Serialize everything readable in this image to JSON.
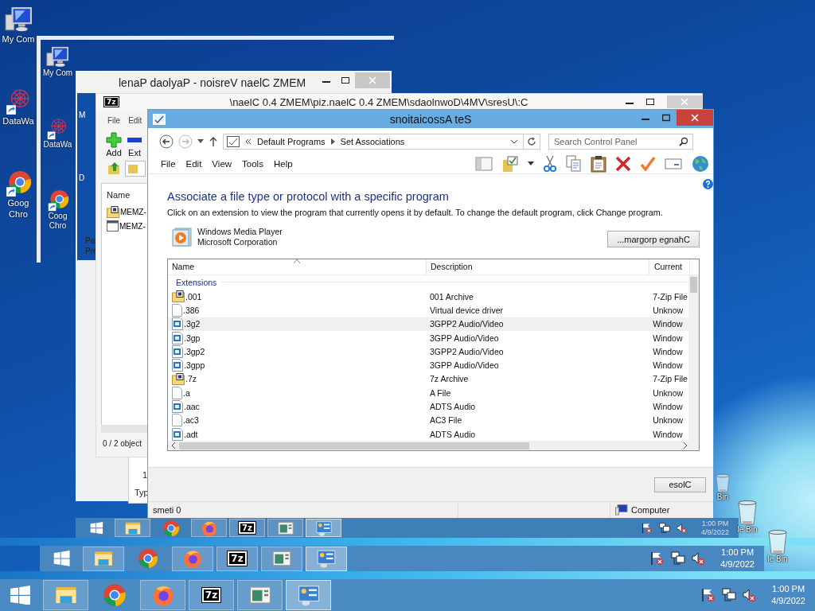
{
  "desktop": {
    "icon_columns": [
      [
        {
          "kind": "computer",
          "lines": [
            "My Com"
          ]
        },
        {
          "kind": "mesh",
          "lines": [
            "DataWa"
          ]
        },
        {
          "kind": "chrome",
          "lines": [
            "Goog",
            "Chro"
          ]
        }
      ],
      [
        {
          "kind": "computer",
          "lines": [
            "My Com"
          ]
        },
        {
          "kind": "mesh",
          "lines": [
            "DataWa"
          ]
        },
        {
          "kind": "chrome",
          "lines": [
            "Coog",
            "Chro"
          ]
        }
      ]
    ],
    "inner_labels": [
      "M",
      "D"
    ],
    "recycle_bins": [
      "Bin",
      "le Bin",
      "le Bin"
    ]
  },
  "taskbars": [
    {
      "items": [
        {
          "kind": "start"
        },
        {
          "kind": "explorer",
          "running": true,
          "selected": false
        },
        {
          "kind": "chrome",
          "running": false,
          "selected": false
        },
        {
          "kind": "firefox",
          "running": true,
          "selected": false
        },
        {
          "kind": "archiver",
          "label": "7z",
          "running": true,
          "selected": false
        },
        {
          "kind": "app",
          "running": true,
          "selected": false
        },
        {
          "kind": "control-panel",
          "running": true,
          "selected": true
        }
      ],
      "time": "1:00 PM",
      "date": "4/9/2022"
    },
    {
      "items": [
        {
          "kind": "start"
        },
        {
          "kind": "explorer",
          "running": true,
          "selected": false
        },
        {
          "kind": "chrome",
          "running": false,
          "selected": false
        },
        {
          "kind": "firefox",
          "running": true,
          "selected": false
        },
        {
          "kind": "archiver",
          "label": "7z",
          "running": true,
          "selected": false
        },
        {
          "kind": "app",
          "running": true,
          "selected": false
        },
        {
          "kind": "control-panel",
          "running": true,
          "selected": true
        }
      ],
      "time": "1:00 PM",
      "date": "4/9/2022"
    },
    {
      "items": [
        {
          "kind": "start"
        },
        {
          "kind": "explorer",
          "running": true,
          "selected": false
        },
        {
          "kind": "chrome",
          "running": false,
          "selected": false
        },
        {
          "kind": "firefox",
          "running": true,
          "selected": false
        },
        {
          "kind": "archiver",
          "label": "7z",
          "running": true,
          "selected": false
        },
        {
          "kind": "app",
          "running": true,
          "selected": false
        },
        {
          "kind": "control-panel",
          "running": true,
          "selected": true
        }
      ],
      "time": "1:00 PM",
      "date": "4/9/2022"
    }
  ],
  "payload_window": {
    "title": "lenaP daolyaP - noisreV naelC ZMEM",
    "labels": [
      "Pa",
      "Pre"
    ],
    "fragments": [
      "1",
      "Typ"
    ]
  },
  "archive_window": {
    "logo": "7z",
    "title": "\\naelC 0.4 ZMEM\\piz.naelC 0.4 ZMEM\\sdaolnwoD\\4MV\\sresU\\:C",
    "menu": [
      "File",
      "Edit"
    ],
    "tools": [
      {
        "kind": "add",
        "label": "Add"
      },
      {
        "kind": "extract",
        "label": "Ext"
      }
    ],
    "column": "Name",
    "files": [
      {
        "kind": "archive",
        "name": "MEMZ-"
      },
      {
        "kind": "program",
        "name": "MEMZ-"
      }
    ],
    "status": "0 / 2 object"
  },
  "main_window": {
    "title": "snoitaicossA teS",
    "breadcrumb": [
      "Default Programs",
      "Set Associations"
    ],
    "search": {
      "placeholder": "Search Control Panel"
    },
    "menu": [
      "File",
      "Edit",
      "View",
      "Tools",
      "Help"
    ],
    "heading": "Associate a file type or protocol with a specific program",
    "description": "Click on an extension to view the program that currently opens it by default. To change the default program, click Change program.",
    "program": {
      "name": "Windows Media Player",
      "company": "Microsoft Corporation"
    },
    "change_button": "...margorp egnahC",
    "columns": [
      "Name",
      "Description",
      "Current"
    ],
    "group": "Extensions",
    "rows": [
      {
        "kind": "archive",
        "name": ".001",
        "description": "001 Archive",
        "current": "7-Zip File",
        "selected": false
      },
      {
        "kind": "blank",
        "name": ".386",
        "description": "Virtual device driver",
        "current": "Unknow",
        "selected": false
      },
      {
        "kind": "media",
        "name": ".3g2",
        "description": "3GPP2 Audio/Video",
        "current": "Window",
        "selected": true
      },
      {
        "kind": "media",
        "name": ".3gp",
        "description": "3GPP Audio/Video",
        "current": "Window",
        "selected": false
      },
      {
        "kind": "media",
        "name": ".3gp2",
        "description": "3GPP2 Audio/Video",
        "current": "Window",
        "selected": false
      },
      {
        "kind": "media",
        "name": ".3gpp",
        "description": "3GPP Audio/Video",
        "current": "Window",
        "selected": false
      },
      {
        "kind": "archive",
        "name": ".7z",
        "description": "7z Archive",
        "current": "7-Zip File",
        "selected": false
      },
      {
        "kind": "blank",
        "name": ".a",
        "description": "A File",
        "current": "Unknow",
        "selected": false
      },
      {
        "kind": "media",
        "name": ".aac",
        "description": "ADTS Audio",
        "current": "Window",
        "selected": false
      },
      {
        "kind": "blank",
        "name": ".ac3",
        "description": "AC3 File",
        "current": "Unknow",
        "selected": false
      },
      {
        "kind": "media",
        "name": ".adt",
        "description": "ADTS Audio",
        "current": "Window",
        "selected": false
      }
    ],
    "close_button": "esolC",
    "status": "smeti 0",
    "location": "Computer"
  }
}
